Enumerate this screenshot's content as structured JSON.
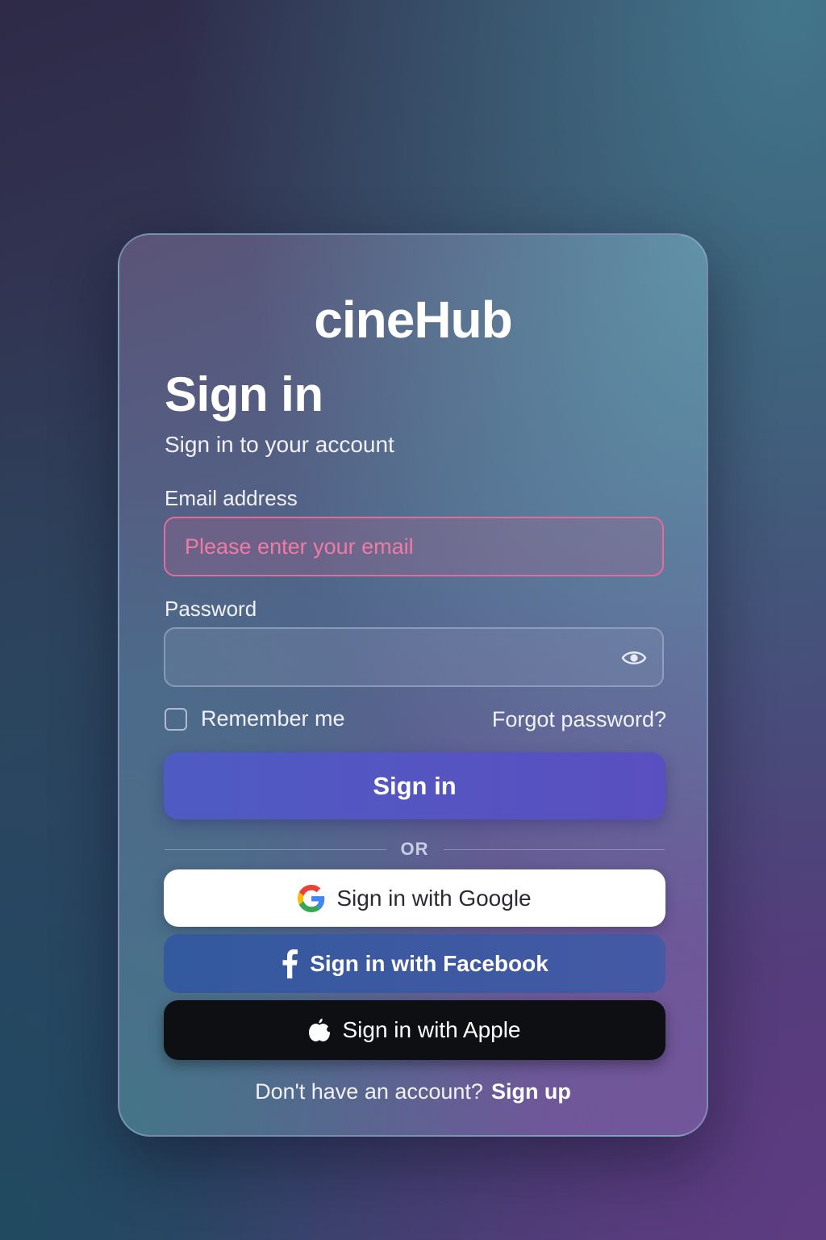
{
  "brand": {
    "logo_text": "cineHub"
  },
  "header": {
    "title": "Sign in",
    "subtitle": "Sign in to your account"
  },
  "form": {
    "email": {
      "label": "Email address",
      "value": "",
      "placeholder": "Please enter your email",
      "state": "error"
    },
    "password": {
      "label": "Password",
      "value": "",
      "visibility_icon": "eye-icon"
    },
    "remember_me": {
      "label": "Remember me",
      "checked": false
    },
    "forgot_password_label": "Forgot password?",
    "submit_label": "Sign in"
  },
  "divider": {
    "label": "OR"
  },
  "social": {
    "google": {
      "label": "Sign in with Google",
      "icon": "google-icon"
    },
    "facebook": {
      "label": "Sign in with Facebook",
      "icon": "facebook-icon"
    },
    "apple": {
      "label": "Sign in with Apple",
      "icon": "apple-icon"
    }
  },
  "footer": {
    "prompt": "Don't have an account?",
    "signup_label": "Sign up"
  },
  "colors": {
    "primary_button": "#5254c2",
    "error_border": "#e46b9a",
    "facebook_blue": "#3b5aa2",
    "apple_black": "#0e0f13"
  }
}
